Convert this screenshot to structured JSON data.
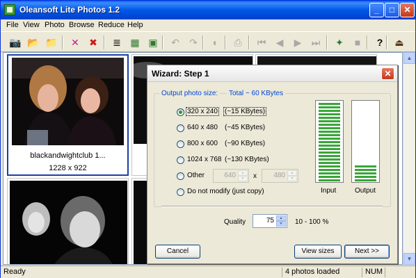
{
  "window": {
    "title": "Oleansoft Lite Photos 1.2",
    "controls": {
      "minimize": "_",
      "maximize": "□",
      "close": "✕"
    }
  },
  "menu": [
    "File",
    "View",
    "Photo",
    "Browse",
    "Reduce",
    "Help"
  ],
  "toolbar": {
    "buttons": [
      {
        "name": "camera-icon",
        "glyph": "📷",
        "enabled": true
      },
      {
        "name": "open-folder-icon",
        "glyph": "📂",
        "enabled": true
      },
      {
        "name": "new-folder-icon",
        "glyph": "📁",
        "enabled": true
      },
      {
        "name": "deselect-icon",
        "glyph": "✕",
        "enabled": true
      },
      {
        "name": "delete-icon",
        "glyph": "✖",
        "enabled": true
      },
      {
        "name": "list-view-icon",
        "glyph": "≣",
        "enabled": true
      },
      {
        "name": "thumbnail-view-icon",
        "glyph": "▦",
        "enabled": true
      },
      {
        "name": "large-thumbnail-icon",
        "glyph": "▣",
        "enabled": true
      },
      {
        "name": "rotate-left-icon",
        "glyph": "↶",
        "enabled": false
      },
      {
        "name": "rotate-right-icon",
        "glyph": "↷",
        "enabled": false
      },
      {
        "name": "contrast-icon",
        "glyph": "◐",
        "enabled": false
      },
      {
        "name": "print-icon",
        "glyph": "⎙",
        "enabled": false
      },
      {
        "name": "first-icon",
        "glyph": "⏮",
        "enabled": false
      },
      {
        "name": "prev-icon",
        "glyph": "◀",
        "enabled": false
      },
      {
        "name": "next-icon",
        "glyph": "▶",
        "enabled": false
      },
      {
        "name": "last-icon",
        "glyph": "⏭",
        "enabled": false
      },
      {
        "name": "wizard-icon",
        "glyph": "✦",
        "enabled": true
      },
      {
        "name": "stop-icon",
        "glyph": "■",
        "enabled": false
      },
      {
        "name": "help-icon",
        "glyph": "?",
        "enabled": true
      },
      {
        "name": "exit-icon",
        "glyph": "⏏",
        "enabled": true
      }
    ]
  },
  "thumbnails": [
    {
      "caption": "blackandwightclub 1...",
      "size": "1228 x 922",
      "selected": true
    }
  ],
  "status": {
    "left": "Ready",
    "count": "4 photos loaded",
    "num": "NUM"
  },
  "wizard": {
    "title": "Wizard: Step 1",
    "group_label": "Output photo size:",
    "total_label": "Total ~ 60 KBytes",
    "options": [
      {
        "label": "320 x 240",
        "size": "(~15 KBytes)",
        "checked": true
      },
      {
        "label": "640 x 480",
        "size": "(~45 KBytes)",
        "checked": false
      },
      {
        "label": "800 x 600",
        "size": "(~90 KBytes)",
        "checked": false
      },
      {
        "label": "1024 x 768",
        "size": "(~130 KBytes)",
        "checked": false
      },
      {
        "label": "Other",
        "size": "",
        "checked": false
      },
      {
        "label": "Do not modify (just copy)",
        "size": "",
        "checked": false
      }
    ],
    "other_width": "640",
    "other_height": "480",
    "times": "x",
    "input_label": "Input",
    "output_label": "Output",
    "input_level": 1.0,
    "output_level": 0.2,
    "quality_label": "Quality",
    "quality_value": "75",
    "quality_range": "10 - 100 %",
    "buttons": {
      "cancel": "Cancel",
      "view_sizes": "View sizes",
      "next": "Next >>"
    }
  },
  "colors": {
    "titlebar": "#0058e8",
    "accent_text": "#0046d5",
    "bar_fill": "#3aa53a"
  }
}
